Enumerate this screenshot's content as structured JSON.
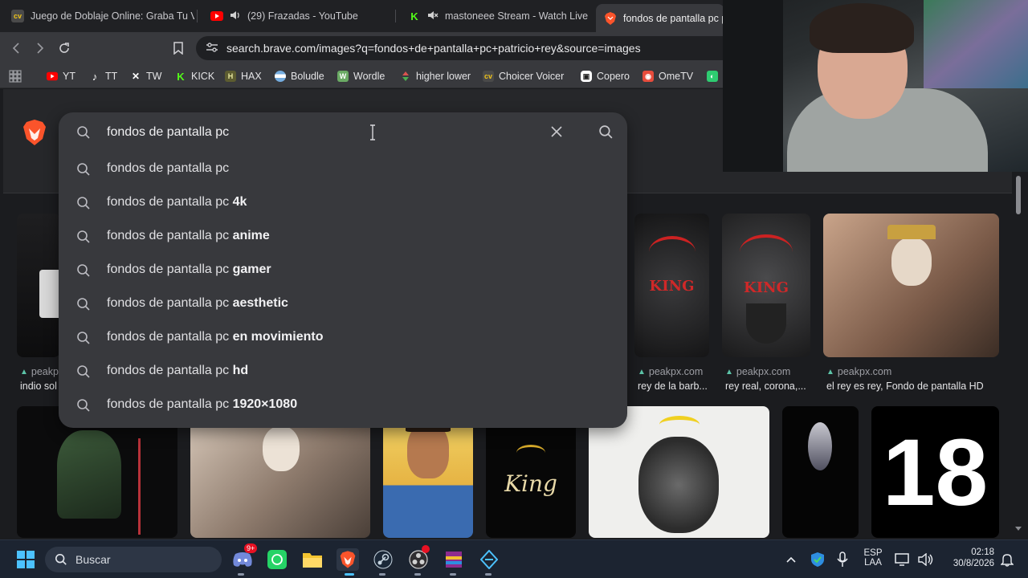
{
  "tabs": [
    {
      "label": "Juego de Doblaje Online: Graba Tu V",
      "favicon": "cv-favicon",
      "color": "#3a3a3a"
    },
    {
      "label": "(29) Frazadas - YouTube",
      "favicon": "youtube-favicon",
      "color": "#ff0000"
    },
    {
      "label": "mastoneee Stream - Watch Live c",
      "favicon": "kick-favicon",
      "color": "#53fc18"
    },
    {
      "label": "fondos de pantalla pc p",
      "favicon": "brave-favicon",
      "color": "#fb542b"
    }
  ],
  "toolbar": {
    "url": "search.brave.com/images?q=fondos+de+pantalla+pc+patricio+rey&source=images"
  },
  "bookmarks": [
    {
      "label": "YT",
      "icon": "youtube-icon",
      "color": "#ff0000"
    },
    {
      "label": "TT",
      "icon": "tiktok-icon",
      "color": "#ffffff"
    },
    {
      "label": "TW",
      "icon": "x-icon",
      "color": "#ffffff"
    },
    {
      "label": "KICK",
      "icon": "kick-icon",
      "color": "#53fc18"
    },
    {
      "label": "HAX",
      "icon": "hax-icon",
      "color": "#6b6b3a"
    },
    {
      "label": "Boludle",
      "icon": "argentina-flag-icon",
      "color": "#74acdf"
    },
    {
      "label": "Wordle",
      "icon": "wordle-icon",
      "color": "#6aaa64"
    },
    {
      "label": "higher lower",
      "icon": "higher-lower-icon",
      "color": "#d9534f"
    },
    {
      "label": "Choicer Voicer",
      "icon": "cv-icon",
      "color": "#f0c419"
    },
    {
      "label": "Copero",
      "icon": "copero-icon",
      "color": "#ffffff"
    },
    {
      "label": "OmeTV",
      "icon": "ometv-icon",
      "color": "#e74c3c"
    }
  ],
  "search": {
    "query": "fondos de pantalla pc",
    "suggestions": [
      {
        "base": "fondos de pantalla pc",
        "extra": ""
      },
      {
        "base": "fondos de pantalla pc ",
        "extra": "4k"
      },
      {
        "base": "fondos de pantalla pc ",
        "extra": "anime"
      },
      {
        "base": "fondos de pantalla pc ",
        "extra": "gamer"
      },
      {
        "base": "fondos de pantalla pc ",
        "extra": "aesthetic"
      },
      {
        "base": "fondos de pantalla pc ",
        "extra": "en movimiento"
      },
      {
        "base": "fondos de pantalla pc ",
        "extra": "hd"
      },
      {
        "base": "fondos de pantalla pc ",
        "extra": "1920×1080"
      }
    ]
  },
  "results": {
    "row1": [
      {
        "source": "peakp",
        "title": "indio sol"
      },
      {
        "source": "peakpx.com",
        "title": "rey de la barb..."
      },
      {
        "source": "peakpx.com",
        "title": "rey real, corona,..."
      },
      {
        "source": "peakpx.com",
        "title": "el rey es rey, Fondo de pantalla HD"
      }
    ],
    "king_label_1": "KING",
    "king_label_2": "KING",
    "king_script": "King",
    "number_18": "18"
  },
  "taskbar": {
    "search_label": "Buscar",
    "discord_badge": "9+",
    "lang_top": "ESP",
    "lang_bottom": "LAA",
    "time": "02:18",
    "date": "30/8/2026"
  }
}
